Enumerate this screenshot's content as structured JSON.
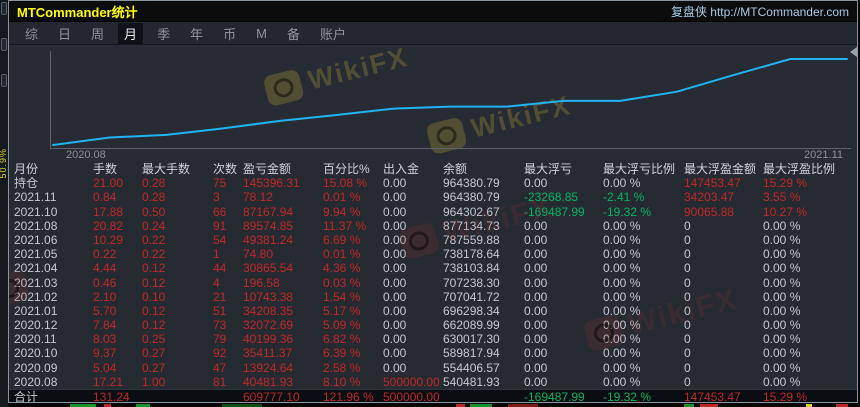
{
  "window": {
    "title": "MTCommander统计",
    "title_right": "复盘侠 http://MTCommander.com"
  },
  "menu": {
    "items": [
      "综",
      "日",
      "周",
      "月",
      "季",
      "年",
      "币",
      "M",
      "备",
      "账户"
    ],
    "selected": "月"
  },
  "watermark": {
    "text": "WikiFX"
  },
  "side_strip": {
    "vertical_text": "50.9%"
  },
  "chart_data": {
    "type": "line",
    "title": "",
    "x_tick_labels": [
      "2020.08",
      "2021.11"
    ],
    "x": [
      "start",
      "2020.08",
      "2020.09",
      "2020.10",
      "2020.11",
      "2020.12",
      "2021.01",
      "2021.02",
      "2021.03",
      "2021.04",
      "2021.05",
      "2021.06",
      "2021.08",
      "2021.10",
      "2021.11"
    ],
    "series": [
      {
        "name": "余额",
        "values": [
          500000.0,
          540481.93,
          554406.57,
          589817.94,
          630017.3,
          662089.99,
          696298.34,
          707041.72,
          707238.3,
          738103.84,
          738178.64,
          787559.88,
          877134.73,
          964302.67,
          964380.79
        ]
      }
    ],
    "ylim": [
      500000,
      975000
    ],
    "grid": false,
    "legend": false,
    "line_color": "#1fb4f2"
  },
  "table": {
    "headers": [
      "月份",
      "手数",
      "最大手数",
      "次数",
      "盈亏金额",
      "百分比%",
      "出入金",
      "余额",
      "最大浮亏",
      "最大浮亏比例",
      "最大浮盈金额",
      "最大浮盈比例"
    ],
    "rows": [
      [
        "持仓",
        "21.00",
        "0.28",
        "75",
        "145396.31",
        "15.08 %",
        "0.00",
        "964380.79",
        "0.00",
        "0.00 %",
        "147453.47",
        "15.29 %"
      ],
      [
        "2021.11",
        "0.84",
        "0.28",
        "3",
        "78.12",
        "0.01 %",
        "0.00",
        "964380.79",
        "-23268.85",
        "-2.41 %",
        "34203.47",
        "3.55 %"
      ],
      [
        "2021.10",
        "17.88",
        "0.50",
        "66",
        "87167.94",
        "9.94 %",
        "0.00",
        "964302.67",
        "-169487.99",
        "-19.32 %",
        "90065.88",
        "10.27 %"
      ],
      [
        "2021.08",
        "20.82",
        "0.24",
        "91",
        "89574.85",
        "11.37 %",
        "0.00",
        "877134.73",
        "0.00",
        "0.00 %",
        "0",
        "0.00 %"
      ],
      [
        "2021.06",
        "10.29",
        "0.22",
        "54",
        "49381.24",
        "6.69 %",
        "0.00",
        "787559.88",
        "0.00",
        "0.00 %",
        "0",
        "0.00 %"
      ],
      [
        "2021.05",
        "0.22",
        "0.22",
        "1",
        "74.80",
        "0.01 %",
        "0.00",
        "738178.64",
        "0.00",
        "0.00 %",
        "0",
        "0.00 %"
      ],
      [
        "2021.04",
        "4.44",
        "0.12",
        "44",
        "30865.54",
        "4.36 %",
        "0.00",
        "738103.84",
        "0.00",
        "0.00 %",
        "0",
        "0.00 %"
      ],
      [
        "2021.03",
        "0.46",
        "0.12",
        "4",
        "196.58",
        "0.03 %",
        "0.00",
        "707238.30",
        "0.00",
        "0.00 %",
        "0",
        "0.00 %"
      ],
      [
        "2021.02",
        "2.10",
        "0.10",
        "21",
        "10743.38",
        "1.54 %",
        "0.00",
        "707041.72",
        "0.00",
        "0.00 %",
        "0",
        "0.00 %"
      ],
      [
        "2021.01",
        "5.70",
        "0.12",
        "51",
        "34208.35",
        "5.17 %",
        "0.00",
        "696298.34",
        "0.00",
        "0.00 %",
        "0",
        "0.00 %"
      ],
      [
        "2020.12",
        "7.84",
        "0.12",
        "73",
        "32072.69",
        "5.09 %",
        "0.00",
        "662089.99",
        "0.00",
        "0.00 %",
        "0",
        "0.00 %"
      ],
      [
        "2020.11",
        "8.03",
        "0.25",
        "79",
        "40199.36",
        "6.82 %",
        "0.00",
        "630017.30",
        "0.00",
        "0.00 %",
        "0",
        "0.00 %"
      ],
      [
        "2020.10",
        "9.37",
        "0.27",
        "92",
        "35411.37",
        "6.39 %",
        "0.00",
        "589817.94",
        "0.00",
        "0.00 %",
        "0",
        "0.00 %"
      ],
      [
        "2020.09",
        "5.04",
        "0.27",
        "47",
        "13924.64",
        "2.58 %",
        "0.00",
        "554406.57",
        "0.00",
        "0.00 %",
        "0",
        "0.00 %"
      ],
      [
        "2020.08",
        "17.21",
        "1.00",
        "81",
        "40481.93",
        "8.10 %",
        "500000.00",
        "540481.93",
        "0.00",
        "0.00 %",
        "0",
        "0.00 %"
      ]
    ],
    "total_row": [
      "合计",
      "131.24",
      "",
      "",
      "609777.10",
      "121.96 %",
      "500000.00",
      "",
      "-169487.99",
      "-19.32 %",
      "147453.47",
      "15.29 %"
    ]
  },
  "colors": {
    "profit_red": "#c02828",
    "loss_green": "#00b763",
    "neutral_gray": "#c3c9d2",
    "title_yellow": "#ffff00",
    "link_blue": "#a6cbe9",
    "equity_line": "#1fb4f2"
  }
}
